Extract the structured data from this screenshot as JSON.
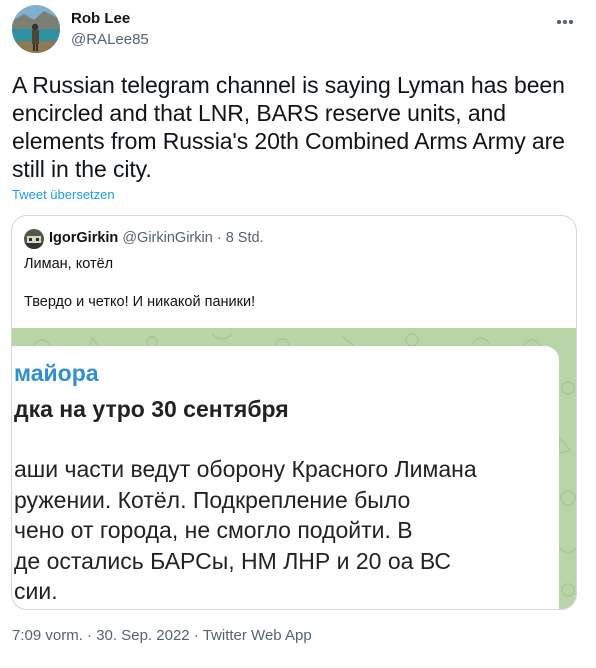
{
  "author": {
    "name": "Rob Lee",
    "handle": "@RALee85"
  },
  "tweet": {
    "text": "A Russian telegram channel is saying Lyman has been encircled and that LNR, BARS reserve units, and elements from Russia's 20th Combined Arms Army are still in the city.",
    "translate_label": "Tweet übersetzen"
  },
  "quoted_tweet": {
    "name": "IgorGirkin",
    "handle": "@GirkinGirkin",
    "separator": "·",
    "time": "8 Std.",
    "text_line1": "Лиман, котёл",
    "text_line2": "Твердо и четко! И никакой паники!",
    "image": {
      "header": "майора",
      "title": "дка на утро 30 сентября",
      "body": "аши части ведут оборону Красного Лимана\nружении. Котёл. Подкрепление было\nчено от города, не смогло подойти. В\nде остались БАРСы, НМ ЛНР и 20 оа ВС\nсии."
    }
  },
  "meta": {
    "time": "7:09 vorm.",
    "sep1": "·",
    "date": "30. Sep. 2022",
    "sep2": "·",
    "source": "Twitter Web App"
  },
  "colors": {
    "link": "#1d9bf0",
    "secondary_text": "#536471",
    "primary_text": "#0f1419",
    "border": "#cfd9de",
    "image_header": "#2f8fcf",
    "image_background": "#b9d4a6"
  },
  "icons": {
    "more": "more-horizontal-icon"
  }
}
